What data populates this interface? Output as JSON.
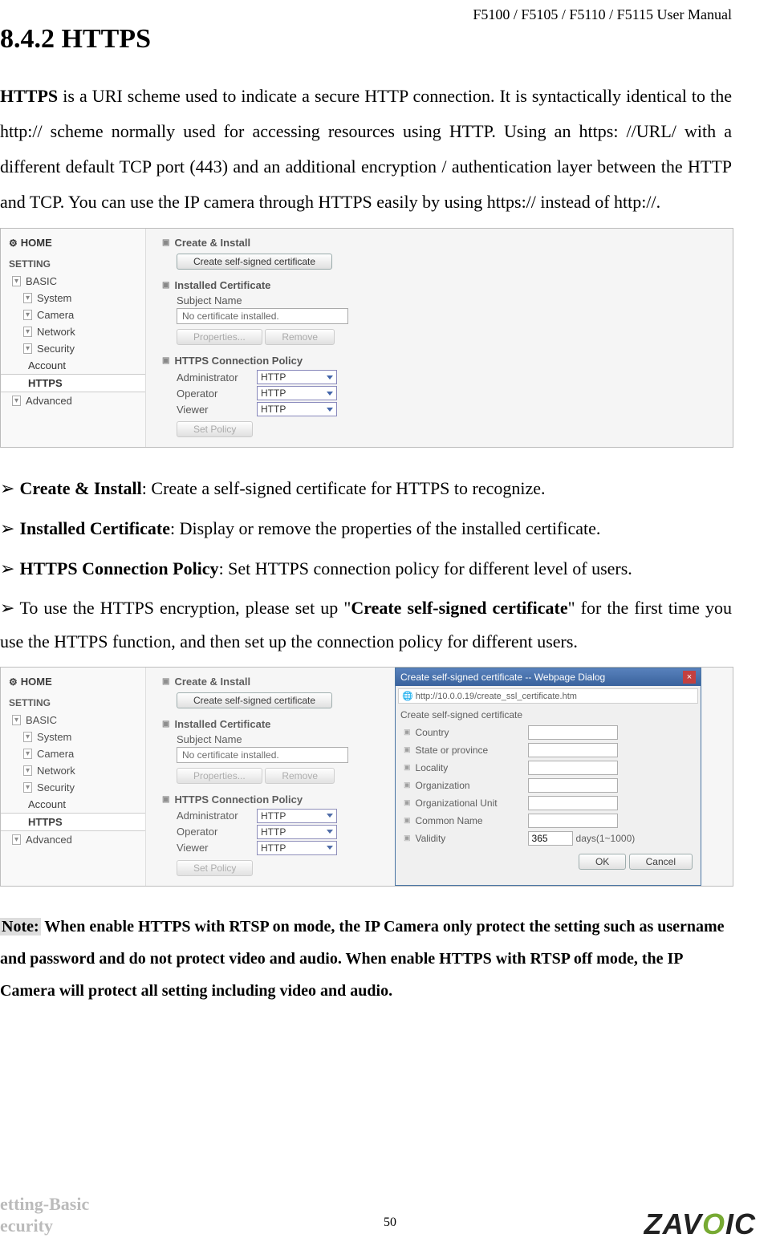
{
  "header": {
    "manual_title": "F5100 / F5105 / F5110 / F5115 User Manual"
  },
  "section": {
    "number_title": "8.4.2 HTTPS"
  },
  "intro": {
    "bold_lead": "HTTPS",
    "rest": " is a URI scheme used to indicate a secure HTTP connection. It is syntactically identical to the http:// scheme normally used for accessing resources using HTTP. Using an https: //URL/ with a different default TCP port (443) and an additional encryption / authentication layer between the HTTP and TCP. You can use the IP camera through HTTPS easily by using https:// instead of http://."
  },
  "sidebar": {
    "home": "HOME",
    "setting": "SETTING",
    "basic": "BASIC",
    "items": {
      "system": "System",
      "camera": "Camera",
      "network": "Network",
      "security": "Security",
      "account": "Account",
      "https": "HTTPS"
    },
    "advanced": "Advanced"
  },
  "https_panel": {
    "create_install": "Create & Install",
    "create_btn": "Create self-signed certificate",
    "installed_cert": "Installed Certificate",
    "subject_name": "Subject Name",
    "no_cert": "No certificate installed.",
    "properties_btn": "Properties...",
    "remove_btn": "Remove",
    "policy": "HTTPS Connection Policy",
    "roles": {
      "admin": "Administrator",
      "operator": "Operator",
      "viewer": "Viewer"
    },
    "proto": "HTTP",
    "set_policy": "Set Policy"
  },
  "bullets": {
    "b1_bold": "Create & Install",
    "b1_rest": ": Create a self-signed certificate for HTTPS to recognize.",
    "b2_bold": "Installed Certificate",
    "b2_rest": ": Display or remove the properties of the installed certificate.",
    "b3_bold": "HTTPS Connection Policy",
    "b3_rest": ": Set HTTPS connection policy for different level of users.",
    "b4_pre": "To use the HTTPS encryption, please set up \"",
    "b4_bold": "Create self-signed certificate",
    "b4_post": "\" for the first time you use the HTTPS function, and then set up the connection policy for different users."
  },
  "dialog": {
    "title": "Create self-signed certificate -- Webpage Dialog",
    "url": "http://10.0.0.19/create_ssl_certificate.htm",
    "head": "Create self-signed certificate",
    "fields": {
      "country": "Country",
      "state": "State or province",
      "locality": "Locality",
      "org": "Organization",
      "orgunit": "Organizational Unit",
      "common": "Common Name",
      "validity": "Validity"
    },
    "validity_value": "365",
    "validity_unit": "days(1~1000)",
    "ok": "OK",
    "cancel": "Cancel"
  },
  "note": {
    "label": "Note:",
    "text": " When enable HTTPS with RTSP on mode, the IP Camera only protect the setting such as username and password and do not protect video and audio. When enable HTTPS with RTSP off mode, the IP Camera will protect all setting including video and audio."
  },
  "footer": {
    "left1": "etting-Basic",
    "left2": "ecurity",
    "page": "50",
    "logo_pre": "ZAV",
    "logo_o": "O",
    "logo_post": "IC"
  }
}
